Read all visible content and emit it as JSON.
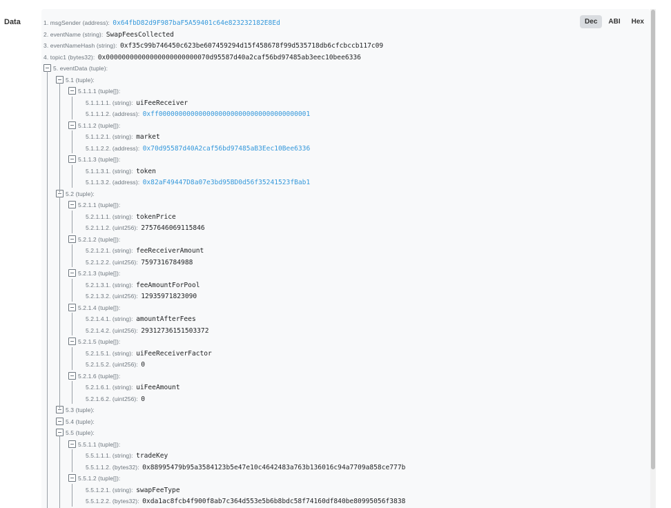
{
  "section_label": "Data",
  "format_buttons": [
    "Dec",
    "ABI",
    "Hex"
  ],
  "active_format": "Dec",
  "rows": [
    {
      "label": "1. msgSender (address):",
      "value": "0x64fbD82d9F987baF5A59401c64e823232182E8Ed",
      "link": true
    },
    {
      "label": "2. eventName (string):",
      "value": "SwapFeesCollected"
    },
    {
      "label": "3. eventNameHash (string):",
      "value": "0xf35c99b746450c623be607459294d15f458678f99d535718db6cfcbccb117c09"
    },
    {
      "label": "4. topic1 (bytes32):",
      "value": "0x00000000000000000000000070d95587d40a2caf56bd97485ab3eec10bee6336"
    },
    {
      "label": "5. eventData (tuple):",
      "value": "",
      "toggle": true
    },
    {
      "label": "5.1 (tuple):",
      "value": "",
      "toggle": true
    },
    {
      "label": "5.1.1.1 (tuple[]):",
      "value": "",
      "toggle": true
    },
    {
      "label": "5.1.1.1.1. (string):",
      "value": "uiFeeReceiver"
    },
    {
      "label": "5.1.1.1.2. (address):",
      "value": "0xff00000000000000000000000000000000000001",
      "link": true
    },
    {
      "label": "5.1.1.2 (tuple[]):",
      "value": "",
      "toggle": true
    },
    {
      "label": "5.1.1.2.1. (string):",
      "value": "market"
    },
    {
      "label": "5.1.1.2.2. (address):",
      "value": "0x70d95587d40A2caf56bd97485aB3Eec10Bee6336",
      "link": true
    },
    {
      "label": "5.1.1.3 (tuple[]):",
      "value": "",
      "toggle": true
    },
    {
      "label": "5.1.1.3.1. (string):",
      "value": "token"
    },
    {
      "label": "5.1.1.3.2. (address):",
      "value": "0x82aF49447D8a07e3bd95BD0d56f35241523fBab1",
      "link": true
    },
    {
      "label": "5.2 (tuple):",
      "value": "",
      "toggle": true
    },
    {
      "label": "5.2.1.1 (tuple[]):",
      "value": "",
      "toggle": true
    },
    {
      "label": "5.2.1.1.1. (string):",
      "value": "tokenPrice"
    },
    {
      "label": "5.2.1.1.2. (uint256):",
      "value": "2757646069115846"
    },
    {
      "label": "5.2.1.2 (tuple[]):",
      "value": "",
      "toggle": true
    },
    {
      "label": "5.2.1.2.1. (string):",
      "value": "feeReceiverAmount"
    },
    {
      "label": "5.2.1.2.2. (uint256):",
      "value": "7597316784988"
    },
    {
      "label": "5.2.1.3 (tuple[]):",
      "value": "",
      "toggle": true
    },
    {
      "label": "5.2.1.3.1. (string):",
      "value": "feeAmountForPool"
    },
    {
      "label": "5.2.1.3.2. (uint256):",
      "value": "12935971823090"
    },
    {
      "label": "5.2.1.4 (tuple[]):",
      "value": "",
      "toggle": true
    },
    {
      "label": "5.2.1.4.1. (string):",
      "value": "amountAfterFees"
    },
    {
      "label": "5.2.1.4.2. (uint256):",
      "value": "29312736151503372"
    },
    {
      "label": "5.2.1.5 (tuple[]):",
      "value": "",
      "toggle": true
    },
    {
      "label": "5.2.1.5.1. (string):",
      "value": "uiFeeReceiverFactor"
    },
    {
      "label": "5.2.1.5.2. (uint256):",
      "value": "0"
    },
    {
      "label": "5.2.1.6 (tuple[]):",
      "value": "",
      "toggle": true
    },
    {
      "label": "5.2.1.6.1. (string):",
      "value": "uiFeeAmount"
    },
    {
      "label": "5.2.1.6.2. (uint256):",
      "value": "0"
    },
    {
      "label": "5.3 (tuple):",
      "value": "",
      "toggle": true
    },
    {
      "label": "5.4 (tuple):",
      "value": "",
      "toggle": true
    },
    {
      "label": "5.5 (tuple):",
      "value": "",
      "toggle": true
    },
    {
      "label": "5.5.1.1 (tuple[]):",
      "value": "",
      "toggle": true
    },
    {
      "label": "5.5.1.1.1. (string):",
      "value": "tradeKey"
    },
    {
      "label": "5.5.1.1.2. (bytes32):",
      "value": "0x88995479b95a3584123b5e47e10c4642483a763b136016c94a7709a858ce777b"
    },
    {
      "label": "5.5.1.2 (tuple[]):",
      "value": "",
      "toggle": true
    },
    {
      "label": "5.5.1.2.1. (string):",
      "value": "swapFeeType"
    },
    {
      "label": "5.5.1.2.2. (bytes32):",
      "value": "0xda1ac8fcb4f900f8ab7c364d553e5b6b8bdc58f74160df840be80995056f3838"
    }
  ]
}
